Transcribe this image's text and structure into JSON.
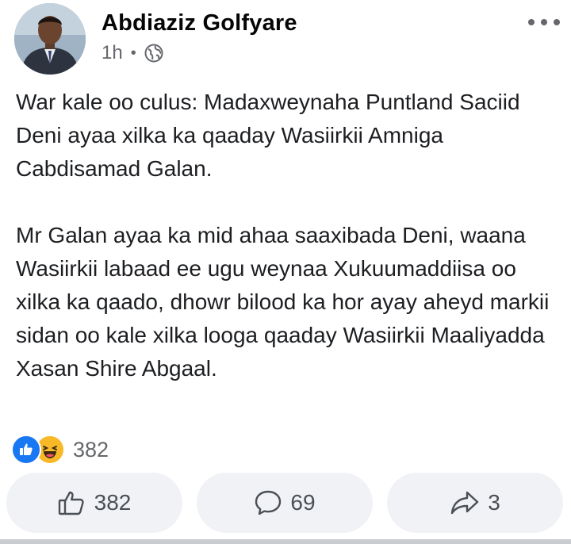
{
  "post": {
    "author": "Abdiaziz Golfyare",
    "time": "1h",
    "separator": "•",
    "audience_icon": "globe-icon",
    "more_icon": "more-dots-icon",
    "paragraphs": [
      "War kale oo culus: Madaxweynaha Puntland Saciid Deni ayaa xilka ka qaaday Wasiirkii Amniga Cabdisamad Galan.",
      "Mr Galan ayaa ka mid ahaa saaxibada Deni, waana Wasiirkii labaad ee ugu weynaa Xukuumaddiisa oo xilka ka qaado, dhowr bilood ka hor ayay aheyd markii sidan oo kale xilka looga qaaday Wasiirkii Maaliyadda Xasan Shire Abgaal."
    ]
  },
  "reactions": {
    "icons": [
      "like-reaction-icon",
      "haha-reaction-icon"
    ],
    "count": "382"
  },
  "actions": {
    "like_count": "382",
    "comment_count": "69",
    "share_count": "3"
  },
  "colors": {
    "like_blue": "#1877f2",
    "haha_yellow": "#f7b928",
    "button_bg": "#f0f2f5",
    "secondary_text": "#65676b"
  }
}
